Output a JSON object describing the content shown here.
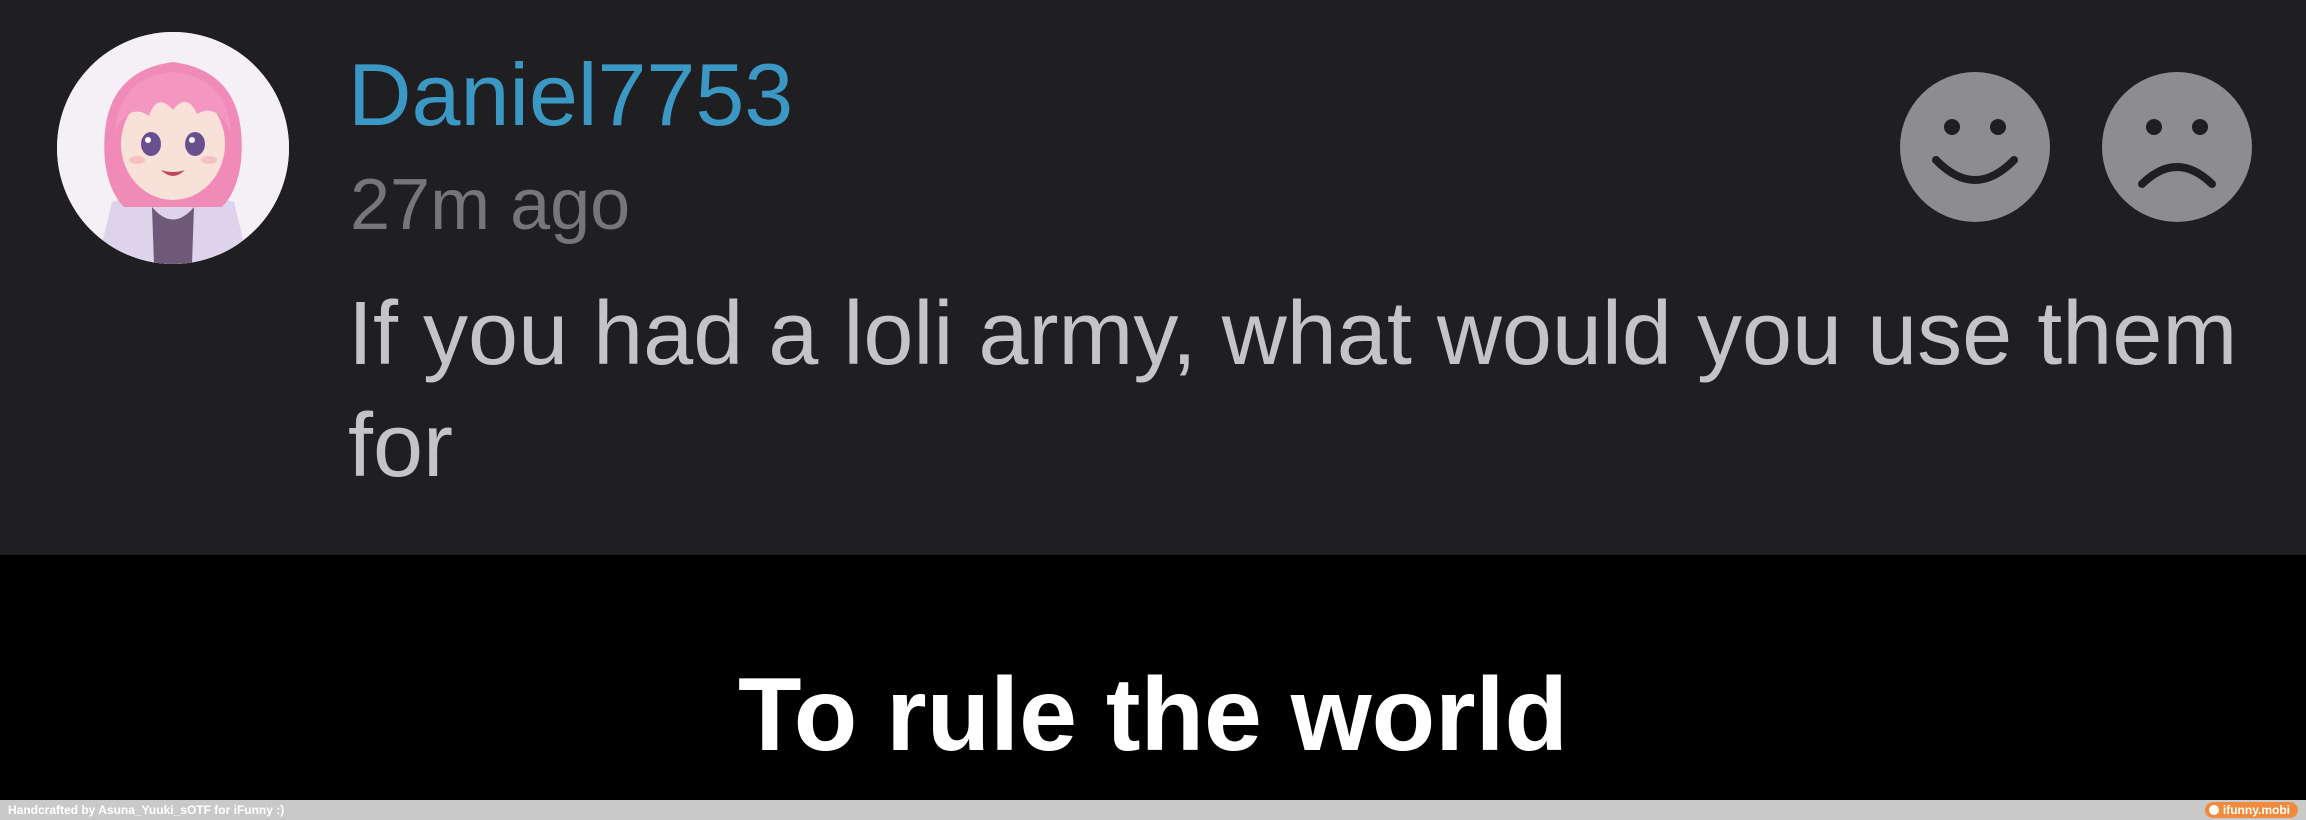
{
  "comment": {
    "username": "Daniel7753",
    "timestamp": "27m ago",
    "body": "If you had a loli army, what would you use them for",
    "reactions": [
      "smile-icon",
      "frown-icon"
    ]
  },
  "caption": {
    "text": "To rule the world"
  },
  "footer": {
    "credit": "Handcrafted by Asuna_Yuuki_sOTF for iFunny :)",
    "site": "ifunny.mobi"
  },
  "colors": {
    "panel_bg": "#1f1e21",
    "username": "#3b98c4",
    "timestamp": "#76767a",
    "body_text": "#c4c4c6",
    "reaction_icon": "#8d8d8f",
    "caption_bg": "#000000",
    "caption_text": "#ffffff",
    "footer_bg": "#c9c9c9",
    "footer_logo": "#f08a3c"
  }
}
